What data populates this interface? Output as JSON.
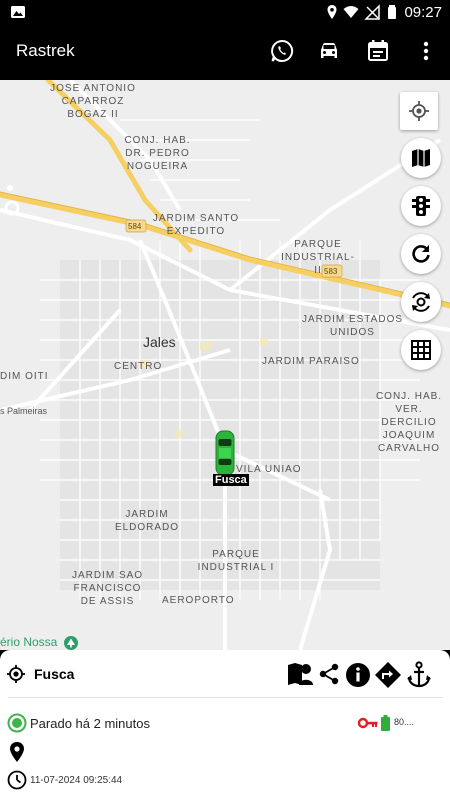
{
  "status_bar": {
    "time": "09:27"
  },
  "app": {
    "title": "Rastrek"
  },
  "map": {
    "road_badges": [
      "584",
      "583"
    ],
    "labels": {
      "jose_antonio": "JOSE ANTONIO CAPARROZ BOGAZ II",
      "conj_hab_pedro": "CONJ. HAB. DR. PEDRO NOGUEIRA",
      "jardim_santo": "JARDIM SANTO EXPEDITO",
      "parque_industrial_ii": "PARQUE INDUSTRIAL-II",
      "jardim_estados": "JARDIM ESTADOS UNIDOS",
      "jales": "Jales",
      "centro": "CENTRO",
      "jardim_paraiso": "JARDIM PARAISO",
      "jardim_oiti": "DIM OITI",
      "palmeiras": "s Palmeiras",
      "conj_hab_vereador": "CONJ. HAB. VER. DERCILIO JOAQUIM CARVALHO",
      "vila_uniao": "VILA UNIAO",
      "jardim_eldorado": "JARDIM ELDORADO",
      "parque_industrial_i": "PARQUE INDUSTRIAL I",
      "jardim_sao_francisco": "JARDIM SAO FRANCISCO DE ASSIS",
      "aeroporto": "AEROPORTO",
      "poi_nossa": "ério Nossa"
    }
  },
  "vehicle": {
    "name": "Fusca",
    "marker_label": "Fusca"
  },
  "panel": {
    "vehicle_name": "Fusca",
    "status_text": "Parado há 2 minutos",
    "battery": "80....",
    "datetime": "11-07-2024 09:25:44"
  },
  "colors": {
    "highway": "#f6cf63",
    "status_green": "#3cb54a",
    "key_red": "#e02020",
    "battery_green": "#2fae3a",
    "car_green": "#2db33d"
  }
}
